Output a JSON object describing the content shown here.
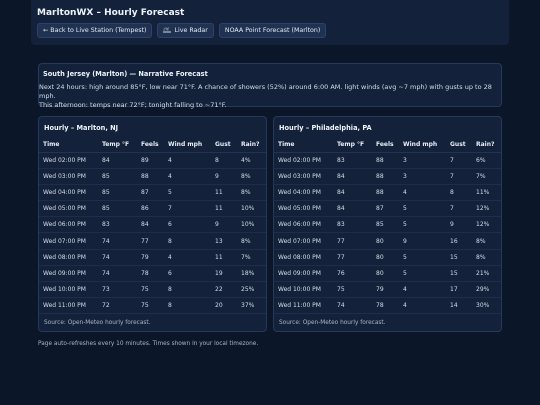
{
  "header": {
    "title": "MarltonWX – Hourly Forecast",
    "nav": [
      {
        "label": "← Back to Live Station (Tempest)",
        "icon": "arrow-left-icon"
      },
      {
        "label": "Live Radar",
        "icon": "radar-icon"
      },
      {
        "label": "NOAA Point Forecast (Marlton)",
        "icon": ""
      }
    ]
  },
  "narrative": {
    "title": "South Jersey (Marlton) — Narrative Forecast",
    "line1": "Next 24 hours: high around 85°F, low near 71°F. A chance of showers (52%) around 6:00 AM. light winds (avg ~7 mph) with gusts up to 28 mph.",
    "line2": "This afternoon: temps near 72°F; tonight falling to ~71°F."
  },
  "columns": [
    "Time",
    "Temp °F",
    "Feels",
    "Wind mph",
    "Gust",
    "Rain?"
  ],
  "hourly": [
    {
      "title": "Hourly – Marlton, NJ",
      "rows": [
        [
          "Wed 02:00 PM",
          "84",
          "89",
          "4",
          "8",
          "4%"
        ],
        [
          "Wed 03:00 PM",
          "85",
          "88",
          "4",
          "9",
          "8%"
        ],
        [
          "Wed 04:00 PM",
          "85",
          "87",
          "5",
          "11",
          "8%"
        ],
        [
          "Wed 05:00 PM",
          "85",
          "86",
          "7",
          "11",
          "10%"
        ],
        [
          "Wed 06:00 PM",
          "83",
          "84",
          "6",
          "9",
          "10%"
        ],
        [
          "Wed 07:00 PM",
          "74",
          "77",
          "8",
          "13",
          "8%"
        ],
        [
          "Wed 08:00 PM",
          "74",
          "79",
          "4",
          "11",
          "7%"
        ],
        [
          "Wed 09:00 PM",
          "74",
          "78",
          "6",
          "19",
          "18%"
        ],
        [
          "Wed 10:00 PM",
          "73",
          "75",
          "8",
          "22",
          "25%"
        ],
        [
          "Wed 11:00 PM",
          "72",
          "75",
          "8",
          "20",
          "37%"
        ]
      ],
      "source": "Source: Open-Meteo hourly forecast."
    },
    {
      "title": "Hourly – Philadelphia, PA",
      "rows": [
        [
          "Wed 02:00 PM",
          "83",
          "88",
          "3",
          "7",
          "6%"
        ],
        [
          "Wed 03:00 PM",
          "84",
          "88",
          "3",
          "7",
          "7%"
        ],
        [
          "Wed 04:00 PM",
          "84",
          "88",
          "4",
          "8",
          "11%"
        ],
        [
          "Wed 05:00 PM",
          "84",
          "87",
          "5",
          "7",
          "12%"
        ],
        [
          "Wed 06:00 PM",
          "83",
          "85",
          "5",
          "9",
          "12%"
        ],
        [
          "Wed 07:00 PM",
          "77",
          "80",
          "9",
          "16",
          "8%"
        ],
        [
          "Wed 08:00 PM",
          "77",
          "80",
          "5",
          "15",
          "8%"
        ],
        [
          "Wed 09:00 PM",
          "76",
          "80",
          "5",
          "15",
          "21%"
        ],
        [
          "Wed 10:00 PM",
          "75",
          "79",
          "4",
          "17",
          "29%"
        ],
        [
          "Wed 11:00 PM",
          "74",
          "78",
          "4",
          "14",
          "30%"
        ]
      ],
      "source": "Source: Open-Meteo hourly forecast."
    }
  ],
  "footer": "Page auto-refreshes every 10 minutes. Times shown in your local timezone."
}
